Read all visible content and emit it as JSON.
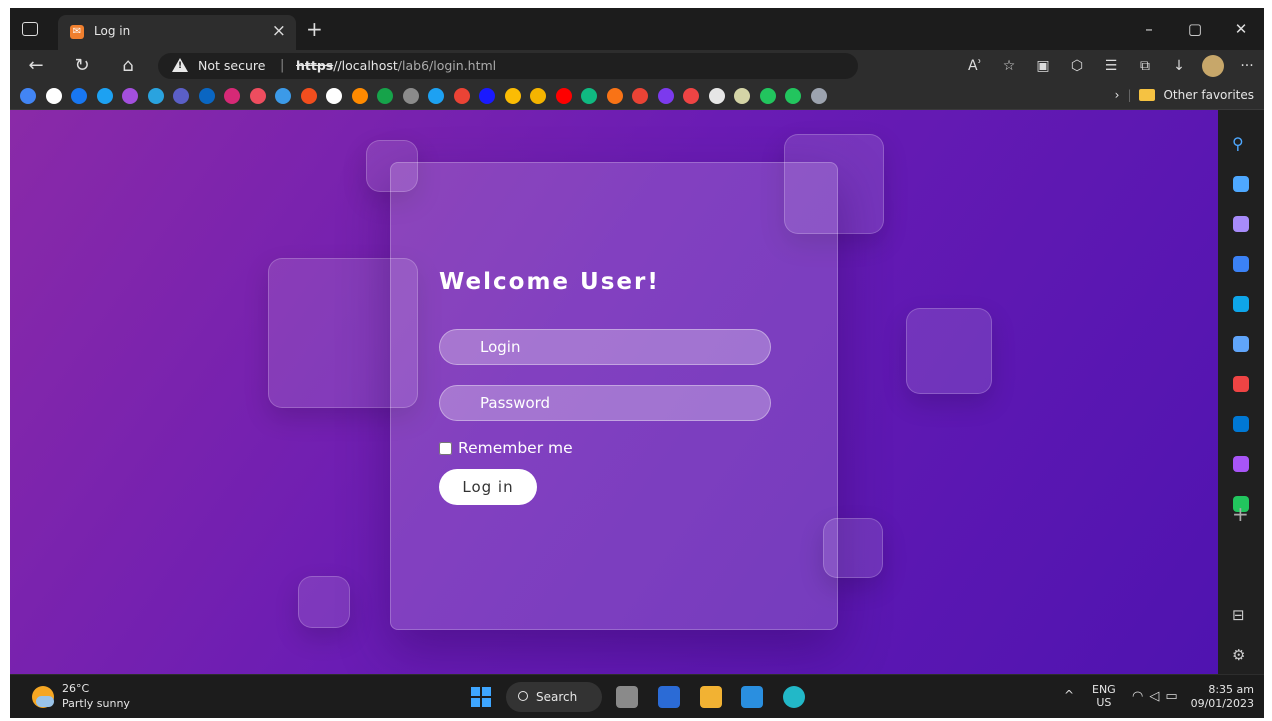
{
  "browser": {
    "tab_title": "Log in",
    "tab_favicon_glyph": "✉",
    "security_label": "Not secure",
    "url_protocol": "https",
    "url_host": "//localhost",
    "url_path": "/lab6/login.html",
    "favorites_label": "Other favorites",
    "favorites_icon_colors": [
      "#4285f4",
      "#ffffff",
      "#1877f2",
      "#1da1f2",
      "#a34fdd",
      "#2aa3df",
      "#5b5fc7",
      "#0a66c2",
      "#d62976",
      "#ee4d5f",
      "#3c9ae8",
      "#f24e1e",
      "#ffffff",
      "#ff8a00",
      "#16a34a",
      "#8b8b8b",
      "#1da1f2",
      "#ea4335",
      "#1a1aff",
      "#fbbc04",
      "#f4b400",
      "#ff0000",
      "#10b981",
      "#f97316",
      "#ea4335",
      "#7c3aed",
      "#ef4444",
      "#e6e6e6",
      "#d4d4a6",
      "#22c55e",
      "#22c55e",
      "#9ca3af"
    ]
  },
  "page": {
    "heading": "Welcome User!",
    "login_placeholder": "Login",
    "password_placeholder": "Password",
    "remember_label": "Remember me",
    "login_button": "Log in",
    "background_colors": [
      "#8a2aa8",
      "#6a1cb4",
      "#4f13b0"
    ]
  },
  "sidebar": {
    "icon_colors": [
      "#4ea8ff",
      "#a78bfa",
      "#3b82f6",
      "#0ea5e9",
      "#60a5fa",
      "#ef4444",
      "#0078d4",
      "#a855f7",
      "#22c55e"
    ]
  },
  "taskbar": {
    "temperature": "26°C",
    "condition": "Partly sunny",
    "search_label": "Search",
    "lang_primary": "ENG",
    "lang_region": "US",
    "time": "8:35 am",
    "date": "09/01/2023"
  }
}
